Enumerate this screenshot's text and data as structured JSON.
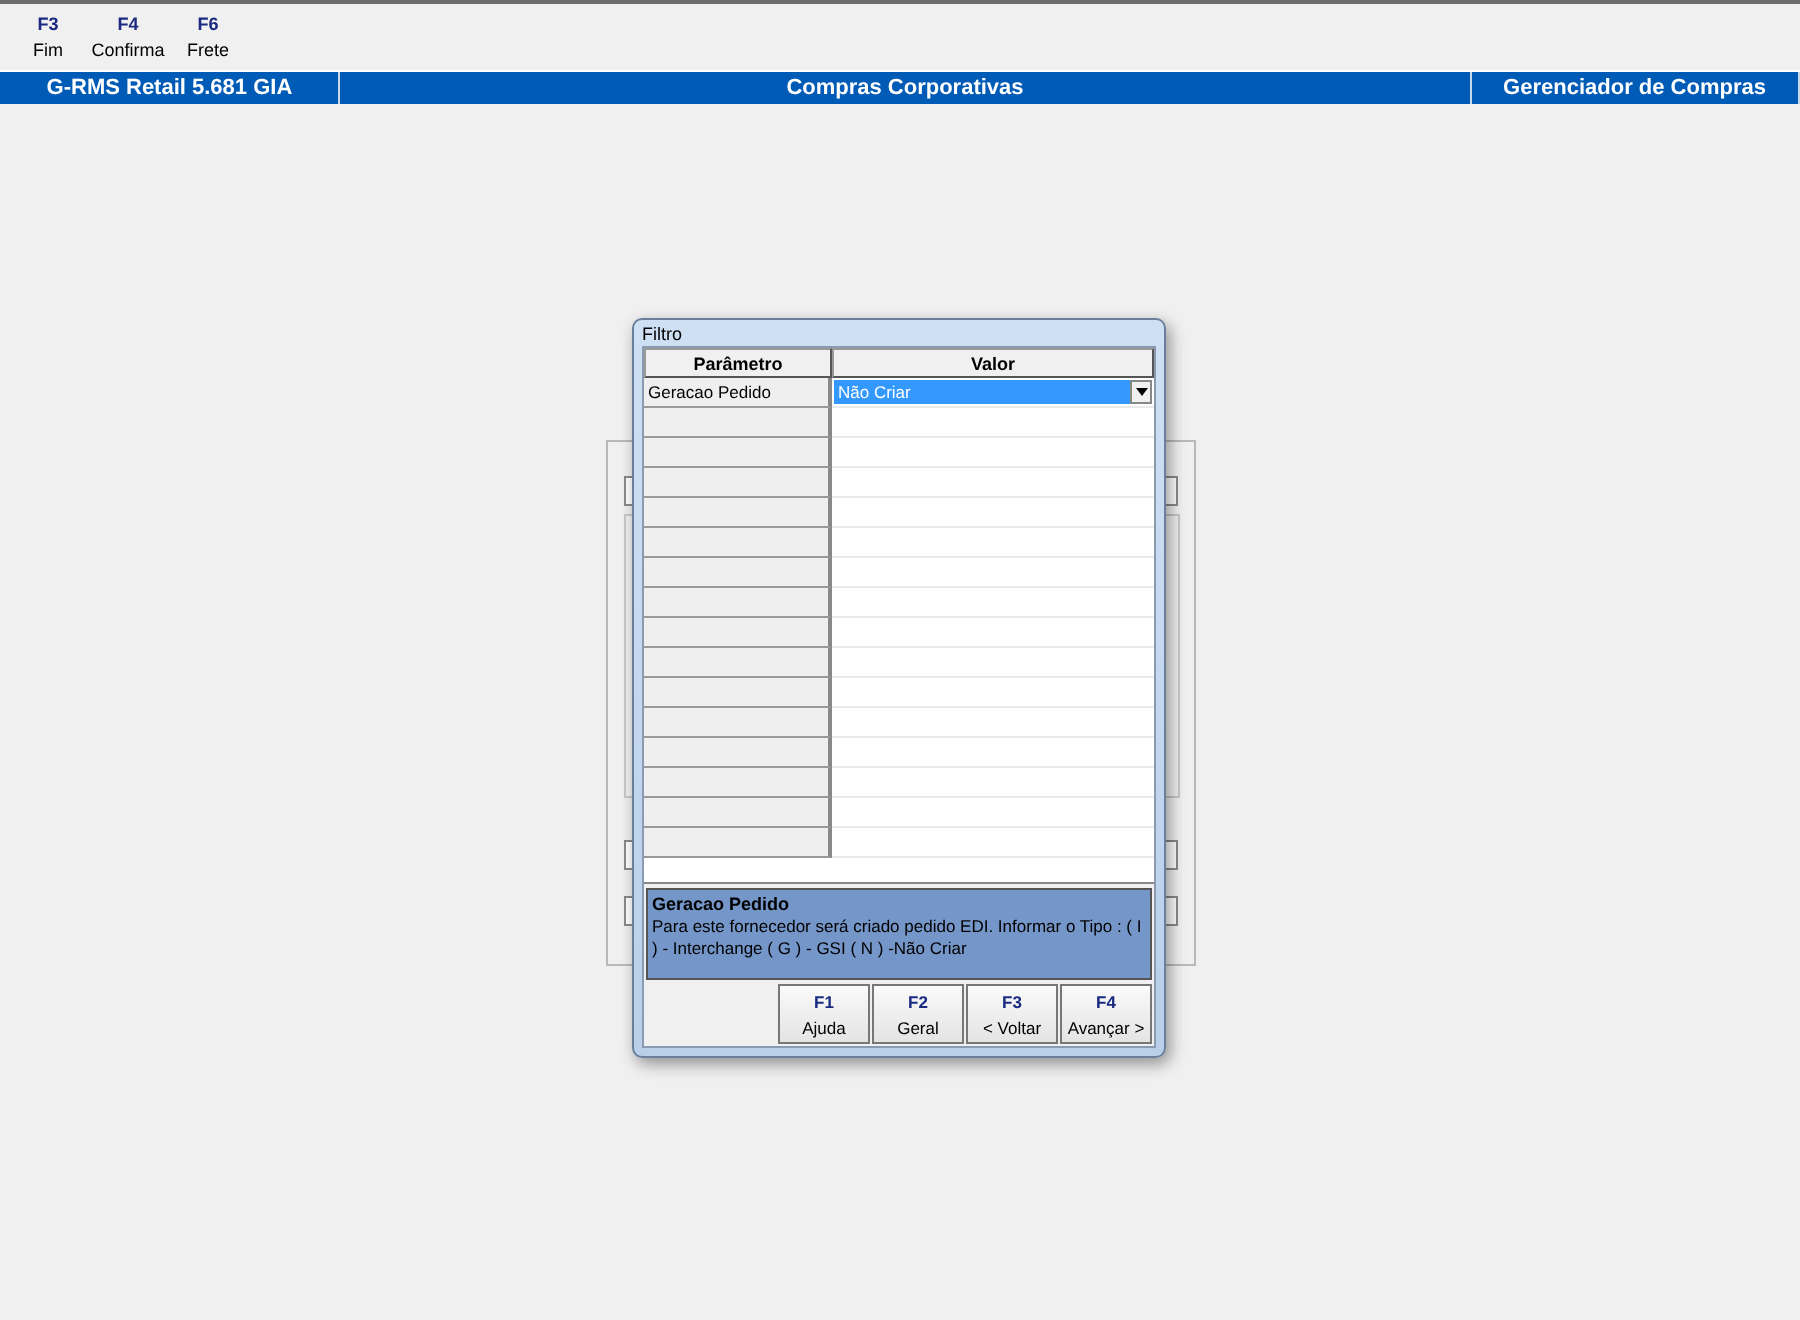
{
  "toolbar": [
    {
      "key": "F3",
      "label": "Fim"
    },
    {
      "key": "F4",
      "label": "Confirma"
    },
    {
      "key": "F6",
      "label": "Frete"
    }
  ],
  "title_bar": [
    "G-RMS Retail 5.681 GIA",
    "Compras Corporativas",
    "Gerenciador de Compras"
  ],
  "dialog": {
    "title": "Filtro",
    "table": {
      "columns": [
        "Parâmetro",
        "Valor"
      ],
      "rows": [
        {
          "parameter": "Geracao Pedido",
          "value": "Não Criar",
          "selected": true
        }
      ]
    },
    "description": {
      "title": "Geracao Pedido",
      "text": "Para este fornecedor será criado pedido EDI. Informar o Tipo : ( I ) - Interchange ( G ) - GSI ( N ) -Não Criar"
    },
    "buttons": [
      {
        "key": "F1",
        "label": "Ajuda"
      },
      {
        "key": "F2",
        "label": "Geral"
      },
      {
        "key": "F3",
        "label": "< Voltar"
      },
      {
        "key": "F4",
        "label": "Avançar >"
      }
    ]
  }
}
